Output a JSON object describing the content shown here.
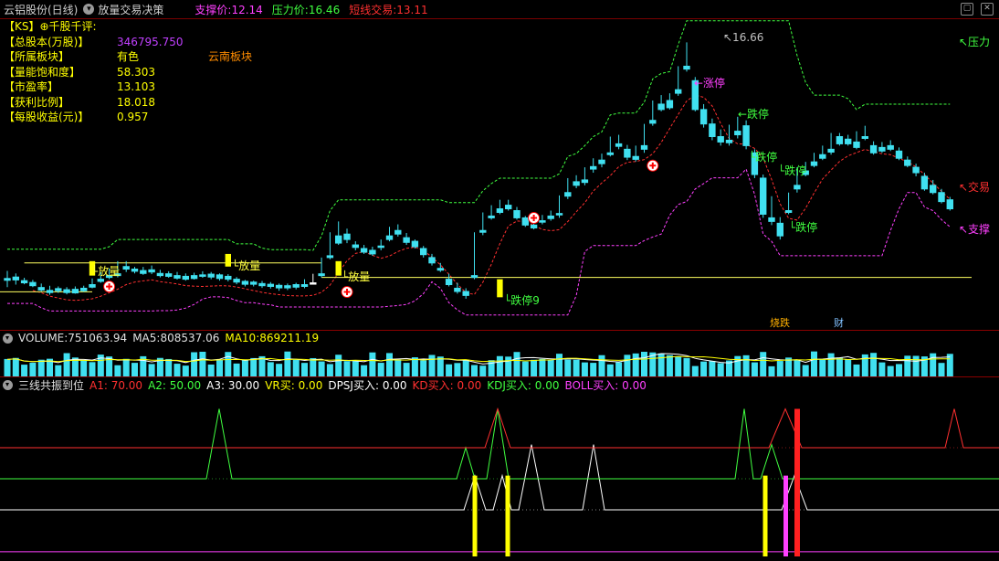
{
  "window": {
    "title": "云铝股份(日线)",
    "strategy_name": "放量交易决策",
    "support_label": "支撑价:",
    "support_value": "12.14",
    "pressure_label": "压力价:",
    "pressure_value": "16.46",
    "short_label": "短线交易:",
    "short_value": "13.11"
  },
  "info_panel": {
    "header": "【KS】⊕千股千评:",
    "rows": [
      {
        "key": "【总股本(万股)】",
        "value": "346795.750",
        "color": "#c040ff"
      },
      {
        "key": "【所属板块】",
        "value": "有色",
        "value2": "云南板块",
        "color": "#ffff00",
        "color2": "#ff8c00"
      },
      {
        "key": "【量能饱和度】",
        "value": "58.303",
        "color": "#ffff00"
      },
      {
        "key": "【市盈率】",
        "value": "13.103",
        "color": "#ffff00"
      },
      {
        "key": "【获利比例】",
        "value": "18.018",
        "color": "#ffff00"
      },
      {
        "key": "【每股收益(元)】",
        "value": "0.957",
        "color": "#ffff00"
      }
    ]
  },
  "chart_labels": {
    "fangliang": "放量",
    "dieting": "跌停",
    "zhangting": "涨停",
    "yali": "压力",
    "jiaoyi": "交易",
    "zhicheng": "支撑",
    "high_mark": "16.66",
    "low_mark": "9",
    "bottom_tag1": "烧跌",
    "bottom_tag2": "财"
  },
  "volume_panel": {
    "label": "VOLUME:",
    "value": "751063.94",
    "ma5_label": "MA5:",
    "ma5_value": "808537.06",
    "ma10_label": "MA10:",
    "ma10_value": "869211.19"
  },
  "indicator_panel": {
    "name": "三线共振到位",
    "items": [
      {
        "label": "A1:",
        "value": "70.00",
        "color": "#ff3030"
      },
      {
        "label": "A2:",
        "value": "50.00",
        "color": "#40ff40"
      },
      {
        "label": "A3:",
        "value": "30.00",
        "color": "#ffffff"
      },
      {
        "label": "VR买:",
        "value": "0.00",
        "color": "#ffff00"
      },
      {
        "label": "DPSJ买入:",
        "value": "0.00",
        "color": "#ffffff"
      },
      {
        "label": "KD买入:",
        "value": "0.00",
        "color": "#ff3030"
      },
      {
        "label": "KDJ买入:",
        "value": "0.00",
        "color": "#40ff40"
      },
      {
        "label": "BOLL买入:",
        "value": "0.00",
        "color": "#ff40ff"
      }
    ]
  },
  "colors": {
    "up": "#ff3060",
    "down": "#40e0f0",
    "flat": "#ffffff",
    "green_line": "#40ff40",
    "magenta_line": "#ff40ff",
    "red_line": "#ff3030",
    "support_line": "#ffff60"
  },
  "chart_data": {
    "type": "candlestick",
    "ohlc": [
      [
        10.12,
        10.33,
        10.07,
        9.88
      ],
      [
        10.16,
        10.26,
        10.08,
        9.95
      ],
      [
        10.06,
        10.14,
        10.0,
        9.96
      ],
      [
        10.01,
        10.08,
        9.92,
        9.88
      ],
      [
        9.87,
        9.98,
        9.8,
        9.76
      ],
      [
        9.79,
        9.92,
        9.73,
        9.67
      ],
      [
        9.84,
        9.9,
        9.78,
        9.72
      ],
      [
        9.81,
        9.88,
        9.73,
        9.68
      ],
      [
        9.82,
        9.9,
        9.72,
        9.7
      ],
      [
        9.85,
        9.92,
        9.78,
        9.75
      ],
      [
        9.95,
        10.12,
        9.88,
        9.85
      ],
      [
        10.1,
        10.3,
        10.04,
        10.0
      ],
      [
        10.2,
        10.4,
        10.15,
        10.1
      ],
      [
        10.25,
        10.6,
        10.2,
        10.15
      ],
      [
        10.45,
        10.6,
        10.38,
        10.3
      ],
      [
        10.38,
        10.44,
        10.32,
        10.26
      ],
      [
        10.34,
        10.44,
        10.26,
        10.22
      ],
      [
        10.36,
        10.48,
        10.3,
        10.24
      ],
      [
        10.26,
        10.36,
        10.2,
        10.15
      ],
      [
        10.25,
        10.32,
        10.18,
        10.14
      ],
      [
        10.2,
        10.3,
        10.13,
        10.09
      ],
      [
        10.18,
        10.26,
        10.1,
        10.06
      ],
      [
        10.2,
        10.28,
        10.12,
        10.09
      ],
      [
        10.22,
        10.32,
        10.18,
        10.14
      ],
      [
        10.24,
        10.3,
        10.16,
        10.1
      ],
      [
        10.22,
        10.26,
        10.12,
        10.06
      ],
      [
        10.18,
        10.24,
        10.1,
        10.04
      ],
      [
        10.1,
        10.16,
        10.02,
        9.96
      ],
      [
        10.04,
        10.08,
        9.96,
        9.9
      ],
      [
        10.02,
        10.06,
        9.96,
        9.9
      ],
      [
        9.98,
        10.05,
        9.92,
        9.86
      ],
      [
        9.96,
        10.02,
        9.9,
        9.84
      ],
      [
        9.93,
        9.98,
        9.86,
        9.78
      ],
      [
        9.92,
        9.98,
        9.86,
        9.8
      ],
      [
        9.95,
        10.0,
        9.88,
        9.82
      ],
      [
        9.95,
        10.1,
        9.9,
        9.85
      ],
      [
        10.0,
        10.25,
        9.98,
        9.95
      ],
      [
        10.25,
        10.7,
        10.2,
        10.15
      ],
      [
        10.75,
        11.4,
        10.7,
        10.65
      ],
      [
        11.3,
        11.7,
        11.1,
        11.05
      ],
      [
        11.35,
        11.5,
        11.2,
        11.1
      ],
      [
        11.05,
        11.15,
        10.98,
        10.9
      ],
      [
        10.95,
        11.05,
        10.85,
        10.8
      ],
      [
        10.9,
        11.0,
        10.8,
        10.75
      ],
      [
        11.02,
        11.2,
        10.98,
        10.9
      ],
      [
        11.3,
        11.55,
        11.2,
        11.15
      ],
      [
        11.45,
        11.62,
        11.35,
        11.28
      ],
      [
        11.25,
        11.38,
        11.12,
        11.05
      ],
      [
        11.15,
        11.2,
        11.0,
        10.95
      ],
      [
        10.95,
        11.02,
        10.78,
        10.7
      ],
      [
        10.7,
        10.8,
        10.55,
        10.48
      ],
      [
        10.4,
        10.55,
        10.35,
        10.3
      ],
      [
        10.1,
        10.25,
        9.95,
        9.9
      ],
      [
        9.85,
        10.0,
        9.76,
        9.7
      ],
      [
        9.76,
        9.85,
        9.65,
        9.56
      ],
      [
        10.2,
        11.4,
        10.15,
        10.1
      ],
      [
        11.45,
        11.95,
        11.4,
        11.32
      ],
      [
        11.85,
        12.15,
        11.8,
        11.75
      ],
      [
        12.05,
        12.3,
        11.95,
        11.9
      ],
      [
        12.15,
        12.3,
        12.05,
        12.0
      ],
      [
        12.0,
        12.1,
        11.8,
        11.75
      ],
      [
        11.8,
        11.85,
        11.6,
        11.55
      ],
      [
        11.6,
        11.72,
        11.52,
        11.48
      ],
      [
        11.72,
        11.88,
        11.68,
        11.62
      ],
      [
        11.85,
        12.0,
        11.78,
        11.72
      ],
      [
        11.92,
        12.42,
        11.88,
        11.8
      ],
      [
        12.5,
        12.9,
        12.4,
        12.32
      ],
      [
        12.8,
        12.98,
        12.7,
        12.62
      ],
      [
        12.85,
        13.2,
        12.78,
        12.7
      ],
      [
        13.22,
        13.45,
        13.15,
        13.05
      ],
      [
        13.4,
        13.58,
        13.3,
        13.2
      ],
      [
        13.6,
        14.05,
        13.55,
        13.5
      ],
      [
        13.85,
        14.1,
        13.78,
        13.7
      ],
      [
        13.7,
        13.82,
        13.48,
        13.4
      ],
      [
        13.5,
        13.8,
        13.42,
        13.36
      ],
      [
        13.8,
        14.4,
        13.7,
        13.6
      ],
      [
        14.5,
        15.05,
        14.42,
        14.35
      ],
      [
        14.95,
        15.2,
        14.8,
        14.75
      ],
      [
        15.05,
        15.25,
        14.85,
        14.8
      ],
      [
        15.35,
        16.0,
        15.25,
        15.18
      ],
      [
        16.0,
        16.66,
        15.92,
        15.85
      ],
      [
        15.6,
        15.7,
        14.8,
        14.75
      ],
      [
        14.8,
        14.95,
        14.4,
        14.3
      ],
      [
        14.4,
        14.55,
        14.05,
        13.95
      ],
      [
        14.05,
        14.25,
        13.9,
        13.8
      ],
      [
        13.95,
        14.38,
        13.88,
        13.8
      ],
      [
        14.2,
        14.6,
        14.1,
        14.0
      ],
      [
        14.35,
        14.5,
        13.8,
        13.7
      ],
      [
        13.6,
        13.7,
        13.0,
        12.9
      ],
      [
        12.9,
        13.0,
        11.9,
        11.8
      ],
      [
        11.8,
        12.4,
        11.7,
        11.6
      ],
      [
        11.65,
        11.82,
        11.3,
        11.2
      ],
      [
        12.0,
        12.5,
        11.95,
        11.9
      ],
      [
        12.7,
        13.2,
        12.6,
        12.5
      ],
      [
        13.1,
        13.35,
        13.0,
        12.95
      ],
      [
        13.35,
        13.6,
        13.25,
        13.2
      ],
      [
        13.55,
        13.8,
        13.45,
        13.4
      ],
      [
        13.7,
        14.15,
        13.62,
        13.55
      ],
      [
        14.05,
        14.15,
        13.85,
        13.8
      ],
      [
        13.98,
        14.1,
        13.85,
        13.8
      ],
      [
        13.9,
        14.2,
        13.75,
        13.7
      ],
      [
        14.05,
        14.35,
        14.0,
        13.95
      ],
      [
        13.8,
        13.92,
        13.6,
        13.55
      ],
      [
        13.75,
        13.9,
        13.65,
        13.6
      ],
      [
        13.8,
        13.95,
        13.7,
        13.65
      ],
      [
        13.65,
        13.75,
        13.45,
        13.4
      ],
      [
        13.4,
        13.5,
        13.25,
        13.2
      ],
      [
        13.2,
        13.3,
        13.05,
        12.95
      ],
      [
        12.95,
        13.05,
        12.6,
        12.55
      ],
      [
        12.7,
        12.85,
        12.5,
        12.45
      ],
      [
        12.5,
        12.6,
        12.25,
        12.2
      ],
      [
        12.3,
        12.38,
        12.05,
        12.0
      ]
    ]
  }
}
